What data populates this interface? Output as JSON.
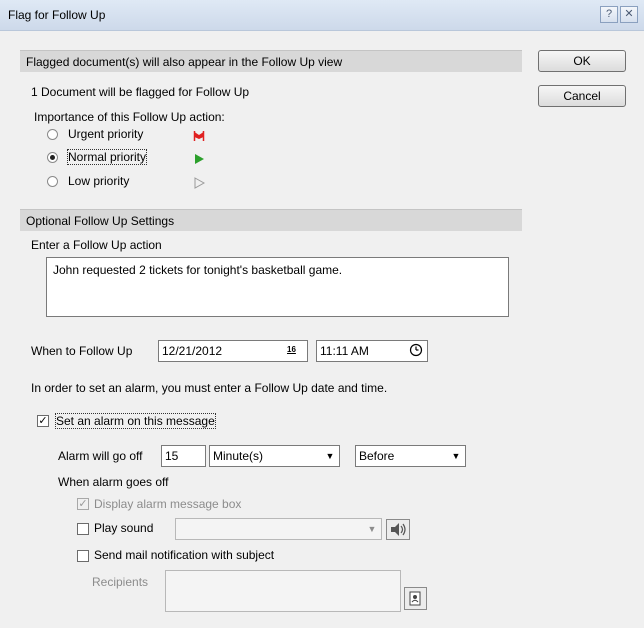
{
  "window": {
    "title": "Flag for Follow Up",
    "help": "?",
    "close": "✕"
  },
  "buttons": {
    "ok": "OK",
    "cancel": "Cancel"
  },
  "section1": {
    "header": "Flagged document(s) will also appear in the Follow Up view",
    "count_text": "1 Document will be flagged for Follow Up",
    "importance_label": "Importance of this Follow Up action:",
    "priorities": [
      {
        "label": "Urgent priority",
        "selected": false,
        "color": "#e02020"
      },
      {
        "label": "Normal priority",
        "selected": true,
        "color": "#2ca02c"
      },
      {
        "label": "Low priority",
        "selected": false,
        "color": "#9a9a9a"
      }
    ]
  },
  "section2": {
    "header": "Optional Follow Up Settings",
    "action_label": "Enter a Follow Up action",
    "action_value": "John requested 2 tickets for tonight's basketball game.",
    "when_label": "When to Follow Up",
    "date_value": "12/21/2012",
    "calendar_icon_text": "16",
    "time_value": "11:11 AM",
    "alarm_note": "In order to set an alarm, you must enter a Follow Up date and time.",
    "set_alarm_label": "Set an alarm on this message",
    "set_alarm_checked": true,
    "alarm_go_off_label": "Alarm will go off",
    "alarm_amount": "15",
    "alarm_unit": "Minute(s)",
    "alarm_relation": "Before",
    "when_goes_off_label": "When alarm goes off",
    "display_box_label": "Display alarm message box",
    "play_sound_label": "Play sound",
    "play_sound_value": "",
    "send_mail_label": "Send mail notification with subject",
    "recipients_label": "Recipients",
    "recipients_value": ""
  }
}
